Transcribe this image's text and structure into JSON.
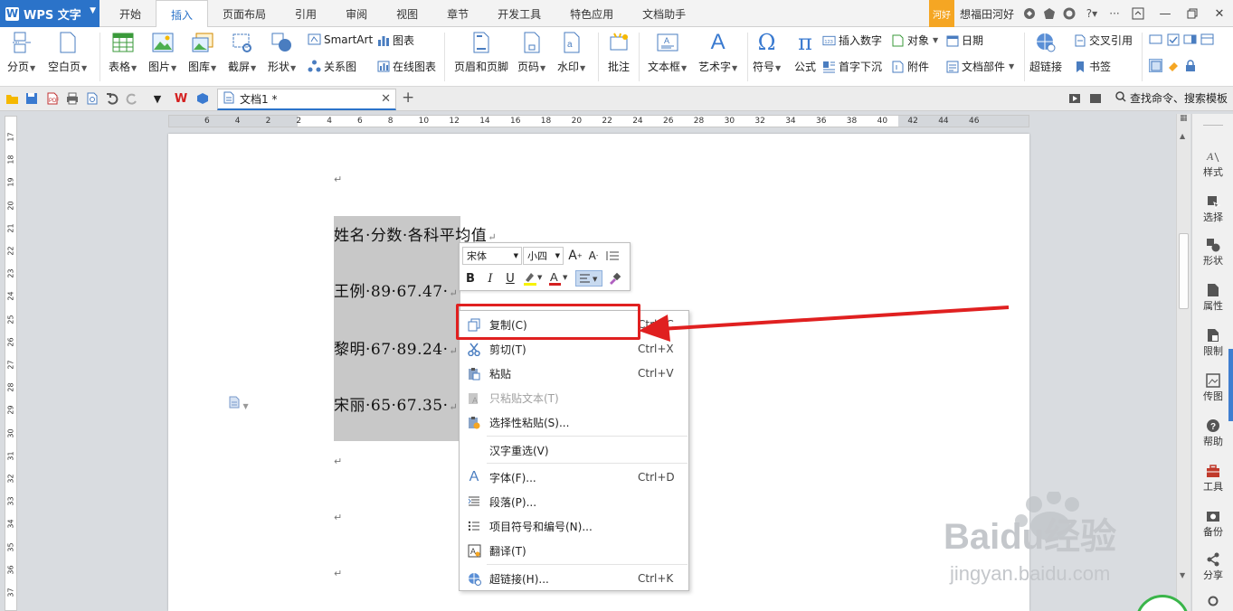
{
  "app": {
    "name": "WPS 文字"
  },
  "menu_tabs": [
    "开始",
    "插入",
    "页面布局",
    "引用",
    "审阅",
    "视图",
    "章节",
    "开发工具",
    "特色应用",
    "文档助手"
  ],
  "active_tab": "插入",
  "title_bar": {
    "badge": "河好",
    "user": "想福田河好"
  },
  "ribbon": {
    "page_break": "分页",
    "blank_page": "空白页",
    "table": "表格",
    "picture": "图片",
    "gallery": "图库",
    "screenshot": "截屏",
    "shape": "形状",
    "smartart": "SmartArt",
    "chart": "图表",
    "relation_chart": "关系图",
    "online_chart": "在线图表",
    "header_footer": "页眉和页脚",
    "page_number": "页码",
    "watermark": "水印",
    "comment": "批注",
    "textbox": "文本框",
    "wordart": "艺术字",
    "symbol": "符号",
    "equation": "公式",
    "insert_number": "插入数字",
    "object": "对象",
    "date": "日期",
    "drop_cap": "首字下沉",
    "attachment": "附件",
    "doc_parts": "文档部件",
    "hyperlink": "超链接",
    "cross_ref": "交叉引用",
    "bookmark": "书签"
  },
  "doc_tab": {
    "title": "文档1 *"
  },
  "search": {
    "placeholder": "查找命令、搜索模板"
  },
  "hruler_nums": [
    "6",
    "4",
    "2",
    "2",
    "4",
    "6",
    "8",
    "10",
    "12",
    "14",
    "16",
    "18",
    "20",
    "22",
    "24",
    "26",
    "28",
    "30",
    "32",
    "34",
    "36",
    "38",
    "40",
    "42",
    "44",
    "46"
  ],
  "vruler_nums": [
    "17",
    "18",
    "19",
    "20",
    "21",
    "22",
    "23",
    "24",
    "25",
    "26",
    "27",
    "28",
    "29",
    "30",
    "31",
    "32",
    "33",
    "34",
    "35",
    "36",
    "37"
  ],
  "document": {
    "lines": [
      "姓名·分数·各科平均值",
      "王例·89·67.47·",
      "黎明·67·89.24·",
      "宋丽·65·67.35·"
    ]
  },
  "mini_toolbar": {
    "font": "宋体",
    "size": "小四"
  },
  "context_menu": [
    {
      "label": "复制(C)",
      "shortcut": "Ctrl+C",
      "icon": "copy-icon"
    },
    {
      "label": "剪切(T)",
      "shortcut": "Ctrl+X",
      "icon": "scissors-icon"
    },
    {
      "label": "粘贴",
      "shortcut": "Ctrl+V",
      "icon": "paste-icon"
    },
    {
      "label": "只粘贴文本(T)",
      "shortcut": "",
      "icon": "paste-text-icon",
      "disabled": true
    },
    {
      "label": "选择性粘贴(S)...",
      "shortcut": "",
      "icon": "paste-special-icon"
    },
    {
      "label": "汉字重选(V)",
      "shortcut": "",
      "icon": ""
    },
    {
      "label": "字体(F)...",
      "shortcut": "Ctrl+D",
      "icon": "font-icon"
    },
    {
      "label": "段落(P)...",
      "shortcut": "",
      "icon": "paragraph-icon"
    },
    {
      "label": "项目符号和编号(N)...",
      "shortcut": "",
      "icon": "list-icon"
    },
    {
      "label": "翻译(T)",
      "shortcut": "",
      "icon": "translate-icon"
    },
    {
      "label": "超链接(H)...",
      "shortcut": "Ctrl+K",
      "icon": "hyperlink-icon"
    }
  ],
  "right_panel": [
    "样式",
    "选择",
    "形状",
    "属性",
    "限制",
    "传图",
    "帮助",
    "工具",
    "备份",
    "分享"
  ],
  "watermark": {
    "brand": "Baidu经验",
    "url": "jingyan.baidu.com"
  },
  "colors": {
    "accent": "#2b73c9",
    "highlight": "#e02020",
    "selection": "#c8c8c8"
  }
}
